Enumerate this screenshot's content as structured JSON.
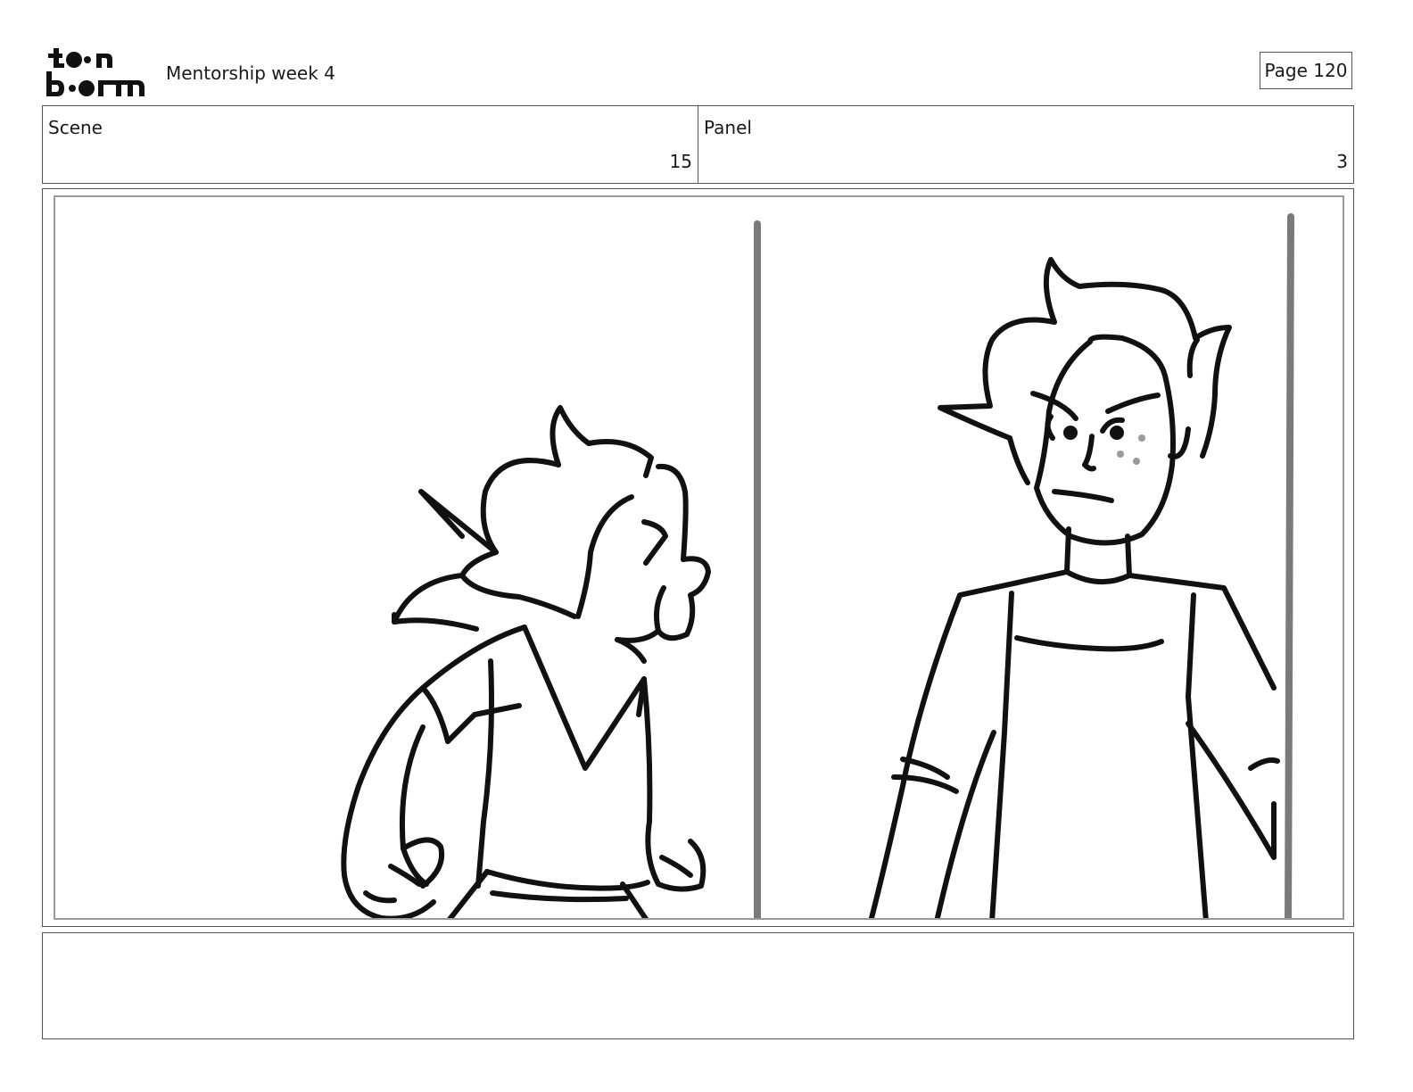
{
  "header": {
    "project_title": "Mentorship week 4",
    "page_label": "Page 120"
  },
  "scene": {
    "label": "Scene",
    "value": "15"
  },
  "panel": {
    "label": "Panel",
    "value": "3"
  },
  "notes": {
    "text": ""
  },
  "colors": {
    "border": "#555555",
    "frame_inner": "#9a9a9a",
    "ink": "#111111",
    "guide": "#7a7a7a"
  }
}
